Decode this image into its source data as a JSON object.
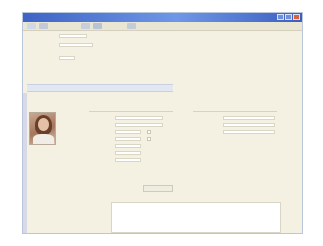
{
  "window": {
    "title": "",
    "titlebar_color": "#3d63c5",
    "controls": [
      "minimize",
      "maximize",
      "close"
    ]
  },
  "menubar": {
    "items": [
      "",
      "",
      ""
    ]
  },
  "header_fields": {
    "labels": [
      "",
      "",
      ""
    ],
    "values": [
      "",
      "",
      ""
    ]
  },
  "section": {
    "title": ""
  },
  "profile": {
    "photo_icon": "person-photo",
    "caption": ""
  },
  "details": {
    "title": "",
    "fields": [
      {
        "label": "",
        "value": ""
      },
      {
        "label": "",
        "value": ""
      },
      {
        "label": "",
        "value": ""
      },
      {
        "label": "",
        "value": ""
      },
      {
        "label": "",
        "value": ""
      },
      {
        "label": "",
        "value": ""
      },
      {
        "label": "",
        "value": ""
      }
    ]
  },
  "contact": {
    "title": "",
    "fields": [
      {
        "label": "",
        "value": ""
      },
      {
        "label": "",
        "value": ""
      },
      {
        "label": "",
        "value": ""
      }
    ]
  },
  "actions": {
    "button_label": ""
  },
  "notes": {
    "label": "",
    "value": ""
  }
}
